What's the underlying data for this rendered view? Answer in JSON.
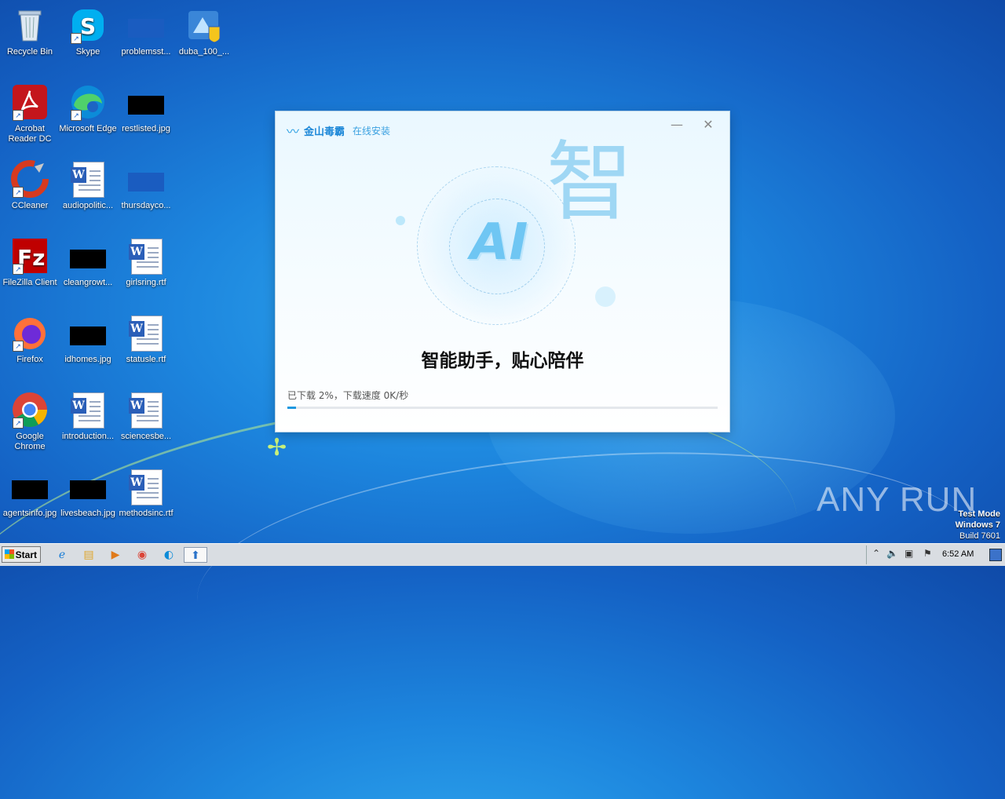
{
  "desktop": {
    "icons": [
      {
        "label": "Recycle Bin",
        "icon": "recycle-bin-icon"
      },
      {
        "label": "Skype",
        "icon": "skype-icon"
      },
      {
        "label": "problemsst...",
        "icon": "image-file-icon"
      },
      {
        "label": "duba_100_...",
        "icon": "installer-icon"
      },
      {
        "label": "Acrobat Reader DC",
        "icon": "acrobat-icon"
      },
      {
        "label": "Microsoft Edge",
        "icon": "edge-icon"
      },
      {
        "label": "restlisted.jpg",
        "icon": "image-file-icon"
      },
      {
        "label": "CCleaner",
        "icon": "ccleaner-icon"
      },
      {
        "label": "audiopolitic...",
        "icon": "word-doc-icon"
      },
      {
        "label": "thursdayco...",
        "icon": "image-file-icon"
      },
      {
        "label": "FileZilla Client",
        "icon": "filezilla-icon"
      },
      {
        "label": "cleangrowt...",
        "icon": "image-file-icon"
      },
      {
        "label": "girlsring.rtf",
        "icon": "word-doc-icon"
      },
      {
        "label": "Firefox",
        "icon": "firefox-icon"
      },
      {
        "label": "idhomes.jpg",
        "icon": "image-file-icon"
      },
      {
        "label": "statusle.rtf",
        "icon": "word-doc-icon"
      },
      {
        "label": "Google Chrome",
        "icon": "chrome-icon"
      },
      {
        "label": "introduction...",
        "icon": "word-doc-icon"
      },
      {
        "label": "sciencesbe...",
        "icon": "word-doc-icon"
      },
      {
        "label": "agentsinfo.jpg",
        "icon": "image-file-icon"
      },
      {
        "label": "livesbeach.jpg",
        "icon": "image-file-icon"
      },
      {
        "label": "methodsinc.rtf",
        "icon": "word-doc-icon"
      }
    ]
  },
  "installer": {
    "brand": "金山毒霸",
    "subtitle": "在线安装",
    "minimize_glyph": "—",
    "close_glyph": "✕",
    "art_ai": "AI",
    "art_zhi": "智",
    "slogan": "智能助手，贴心陪伴",
    "progress_text": "已下载 2%，下载速度 0K/秒",
    "progress_percent": 2
  },
  "taskbar": {
    "start_label": "Start",
    "clock": "6:52 AM",
    "pinned": [
      "ie-icon",
      "explorer-icon",
      "media-player-icon",
      "chrome-icon",
      "edge-icon",
      "duba-installer-icon"
    ]
  },
  "watermark": {
    "text": "ANY RUN",
    "line1": "Test Mode",
    "line2": "Windows 7",
    "line3": "Build 7601"
  }
}
